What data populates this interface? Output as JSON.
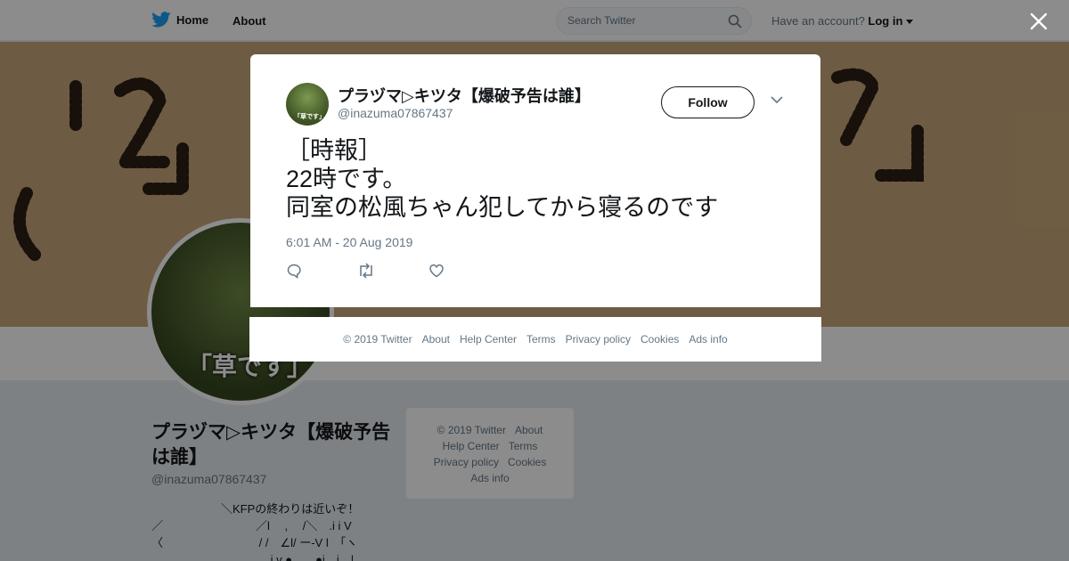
{
  "nav": {
    "home": "Home",
    "about": "About"
  },
  "search": {
    "placeholder": "Search Twitter"
  },
  "account": {
    "prompt": "Have an account?",
    "login": "Log in"
  },
  "profile": {
    "name": "プラヅマ▷キツタ【爆破予告は誰】",
    "handle": "@inazuma07867437",
    "avatar_caption": "「草です」",
    "bio": "　　　　　　＼KFPの終わりは近いぞ！\n／　　　　　　　　／l　 ,　 /＼　.i i V\n〈　　　　　　　　 / /　∠l/ ー-V l　「ヽ\n　　　　　　　　　　 i v ●　　●i　i　|"
  },
  "side_footer": [
    "© 2019 Twitter",
    "About",
    "Help Center",
    "Terms",
    "Privacy policy",
    "Cookies",
    "Ads info"
  ],
  "tweet": {
    "name": "プラヅマ▷キツタ【爆破予告は誰】",
    "handle": "@inazuma07867437",
    "avatar_caption": "「草です」",
    "follow_label": "Follow",
    "text": "［時報］\n22時です。\n同室の松風ちゃん犯してから寝るのです",
    "timestamp": "6:01 AM - 20 Aug 2019"
  },
  "footer": [
    "© 2019 Twitter",
    "About",
    "Help Center",
    "Terms",
    "Privacy policy",
    "Cookies",
    "Ads info"
  ],
  "colors": {
    "twitter_blue": "#1da1f2",
    "text": "#14171a",
    "muted": "#657786"
  },
  "icons": [
    "twitter-bird-icon",
    "search-icon",
    "caret-down-icon",
    "close-icon",
    "chevron-down-icon",
    "reply-icon",
    "retweet-icon",
    "like-icon"
  ]
}
